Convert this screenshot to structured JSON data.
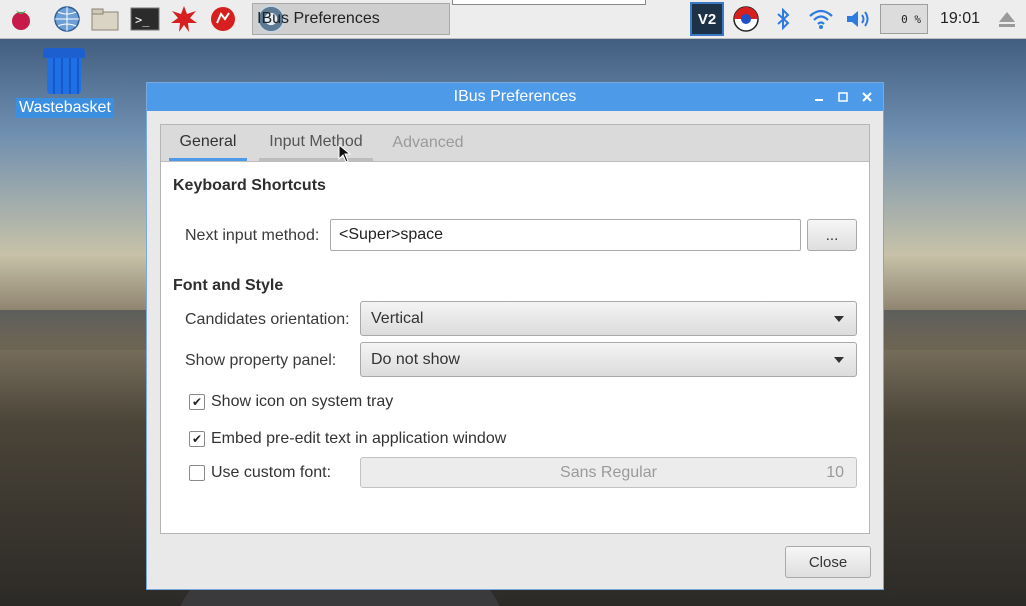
{
  "taskbar": {
    "launchers": [
      "raspberry-icon",
      "globe-icon",
      "folder-icon",
      "terminal-icon",
      "burst-icon",
      "wolfram-icon"
    ],
    "active_task": "IBus Preferences",
    "tray": {
      "vnc_label": "V2",
      "cpu_label": "0 %",
      "clock": "19:01"
    }
  },
  "desktop": {
    "icon_label": "Wastebasket"
  },
  "dialog": {
    "title": "IBus Preferences",
    "tabs": [
      {
        "label": "General"
      },
      {
        "label": "Input Method"
      },
      {
        "label": "Advanced"
      }
    ],
    "keyboard_shortcuts": {
      "heading": "Keyboard Shortcuts",
      "next_label": "Next input method:",
      "next_value": "<Super>space",
      "browse_label": "..."
    },
    "font_style": {
      "heading": "Font and Style",
      "orientation_label": "Candidates orientation:",
      "orientation_value": "Vertical",
      "panel_label": "Show property panel:",
      "panel_value": "Do not show",
      "show_icon_label": "Show icon on system tray",
      "show_icon_checked": true,
      "embed_label": "Embed pre-edit text in application window",
      "embed_checked": true,
      "custom_font_label": "Use custom font:",
      "custom_font_checked": false,
      "font_name": "Sans Regular",
      "font_size": "10"
    },
    "close_label": "Close"
  },
  "colors": {
    "accent": "#4d9ae8",
    "selection": "#3b8fe1"
  }
}
